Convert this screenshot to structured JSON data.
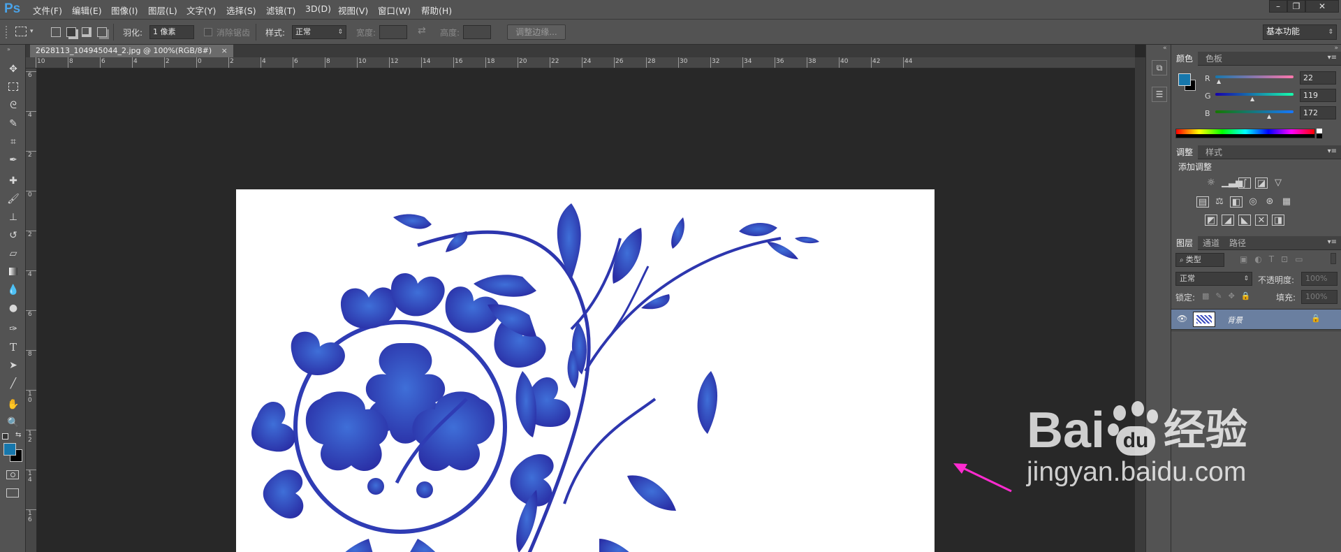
{
  "app": {
    "logo": "Ps"
  },
  "menu": [
    "文件(F)",
    "编辑(E)",
    "图像(I)",
    "图层(L)",
    "文字(Y)",
    "选择(S)",
    "滤镜(T)",
    "3D(D)",
    "视图(V)",
    "窗口(W)",
    "帮助(H)"
  ],
  "window_controls": {
    "minimize": "–",
    "restore": "❐",
    "close": "✕"
  },
  "options": {
    "feather_label": "羽化:",
    "feather_value": "1 像素",
    "antialias_label": "消除锯齿",
    "style_label": "样式:",
    "style_value": "正常",
    "width_label": "宽度:",
    "height_label": "高度:",
    "refine_edge": "调整边缘...",
    "workspace": "基本功能"
  },
  "document": {
    "tab_title": "2628113_104945044_2.jpg @ 100%(RGB/8#)",
    "close": "×"
  },
  "rulers": {
    "h_labels": [
      "10",
      "8",
      "6",
      "4",
      "2",
      "0",
      "2",
      "4",
      "6",
      "8",
      "10",
      "12",
      "14",
      "16",
      "18",
      "20",
      "22",
      "24",
      "26",
      "28",
      "30",
      "32",
      "34",
      "36",
      "38",
      "40",
      "42",
      "44"
    ],
    "v_labels": [
      "6",
      "4",
      "2",
      "0",
      "2",
      "4",
      "6",
      "8",
      "1\n0",
      "1\n2",
      "1\n4",
      "1\n6"
    ]
  },
  "color_panel": {
    "tabs": [
      "颜色",
      "色板"
    ],
    "r_label": "R",
    "r_value": "22",
    "g_label": "G",
    "g_value": "119",
    "b_label": "B",
    "b_value": "172",
    "foreground": "#1677ac",
    "background": "#000000"
  },
  "adjust_panel": {
    "tabs": [
      "调整",
      "样式"
    ],
    "title": "添加调整"
  },
  "layers_panel": {
    "tabs": [
      "图层",
      "通道",
      "路径"
    ],
    "filter_label": "类型",
    "blend_mode": "正常",
    "opacity_label": "不透明度:",
    "opacity_value": "100%",
    "lock_label": "锁定:",
    "fill_label": "填充:",
    "fill_value": "100%",
    "layer_name": "背景"
  },
  "watermark": {
    "brand": "Bai",
    "brand2": "du",
    "cn": "经验",
    "url": "jingyan.baidu.com"
  }
}
